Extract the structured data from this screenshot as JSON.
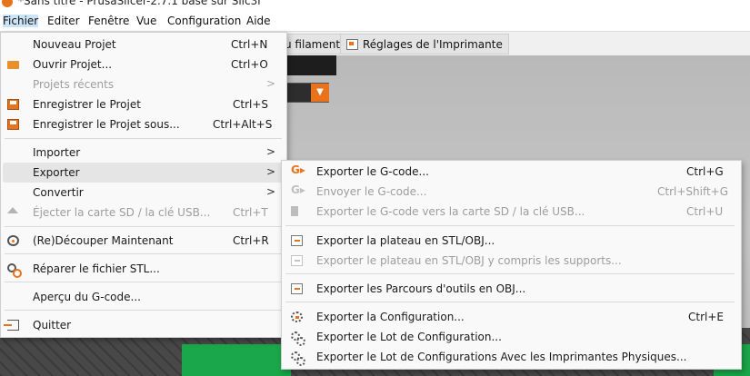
{
  "window": {
    "title": "*Sans titre - PrusaSlicer-2.7.1 basé sur Slic3r"
  },
  "menubar": [
    "Fichier",
    "Editer",
    "Fenêtre",
    "Vue",
    "Configuration",
    "Aide"
  ],
  "tabs": {
    "filament": "u filament",
    "printer": "Réglages de l'Imprimante"
  },
  "file_menu": {
    "items": [
      {
        "label": "Nouveau Projet",
        "shortcut": "Ctrl+N",
        "icon": "none"
      },
      {
        "label": "Ouvrir Projet...",
        "shortcut": "Ctrl+O",
        "icon": "folder-icon"
      },
      {
        "label": "Projets récents",
        "shortcut": "",
        "icon": "none",
        "disabled": true,
        "arrow": ">"
      },
      {
        "label": "Enregistrer le Projet",
        "shortcut": "Ctrl+S",
        "icon": "save-icon"
      },
      {
        "label": "Enregistrer le Projet sous...",
        "shortcut": "Ctrl+Alt+S",
        "icon": "save-as-icon"
      },
      {
        "label": "Importer",
        "shortcut": "",
        "arrow": ">"
      },
      {
        "label": "Exporter",
        "shortcut": "",
        "arrow": ">"
      },
      {
        "label": "Convertir",
        "shortcut": "",
        "arrow": ">"
      },
      {
        "label": "Éjecter la carte SD / la clé USB...",
        "shortcut": "Ctrl+T",
        "icon": "eject-icon",
        "disabled": true
      },
      {
        "label": "(Re)Découper Maintenant",
        "shortcut": "Ctrl+R",
        "icon": "slice-icon"
      },
      {
        "label": "Réparer le fichier STL...",
        "shortcut": "",
        "icon": "repair-icon"
      },
      {
        "label": "Aperçu du G-code...",
        "shortcut": ""
      },
      {
        "label": "Quitter",
        "shortcut": "",
        "icon": "quit-icon"
      }
    ]
  },
  "export_menu": {
    "items": [
      {
        "label": "Exporter le G-code...",
        "shortcut": "Ctrl+G",
        "icon": "gcode-export-icon"
      },
      {
        "label": "Envoyer le G-code...",
        "shortcut": "Ctrl+Shift+G",
        "icon": "gcode-send-icon",
        "disabled": true
      },
      {
        "label": "Exporter le G-code vers la carte SD / la clé USB...",
        "shortcut": "Ctrl+U",
        "icon": "sd-card-icon",
        "disabled": true
      },
      {
        "label": "Exporter la plateau en STL/OBJ...",
        "shortcut": "",
        "icon": "export-plate-icon"
      },
      {
        "label": "Exporter le plateau en STL/OBJ y compris les supports...",
        "shortcut": "",
        "icon": "export-plate-supports-icon",
        "disabled": true
      },
      {
        "label": "Exporter les Parcours d'outils en OBJ...",
        "shortcut": "",
        "icon": "export-toolpaths-icon"
      },
      {
        "label": "Exporter la Configuration...",
        "shortcut": "Ctrl+E",
        "icon": "export-config-icon"
      },
      {
        "label": "Exporter le Lot de Configuration...",
        "shortcut": "",
        "icon": "export-bundle-icon"
      },
      {
        "label": "Exporter le Lot de Configurations Avec les Imprimantes Physiques...",
        "shortcut": "",
        "icon": "export-bundle-physical-icon"
      }
    ]
  }
}
